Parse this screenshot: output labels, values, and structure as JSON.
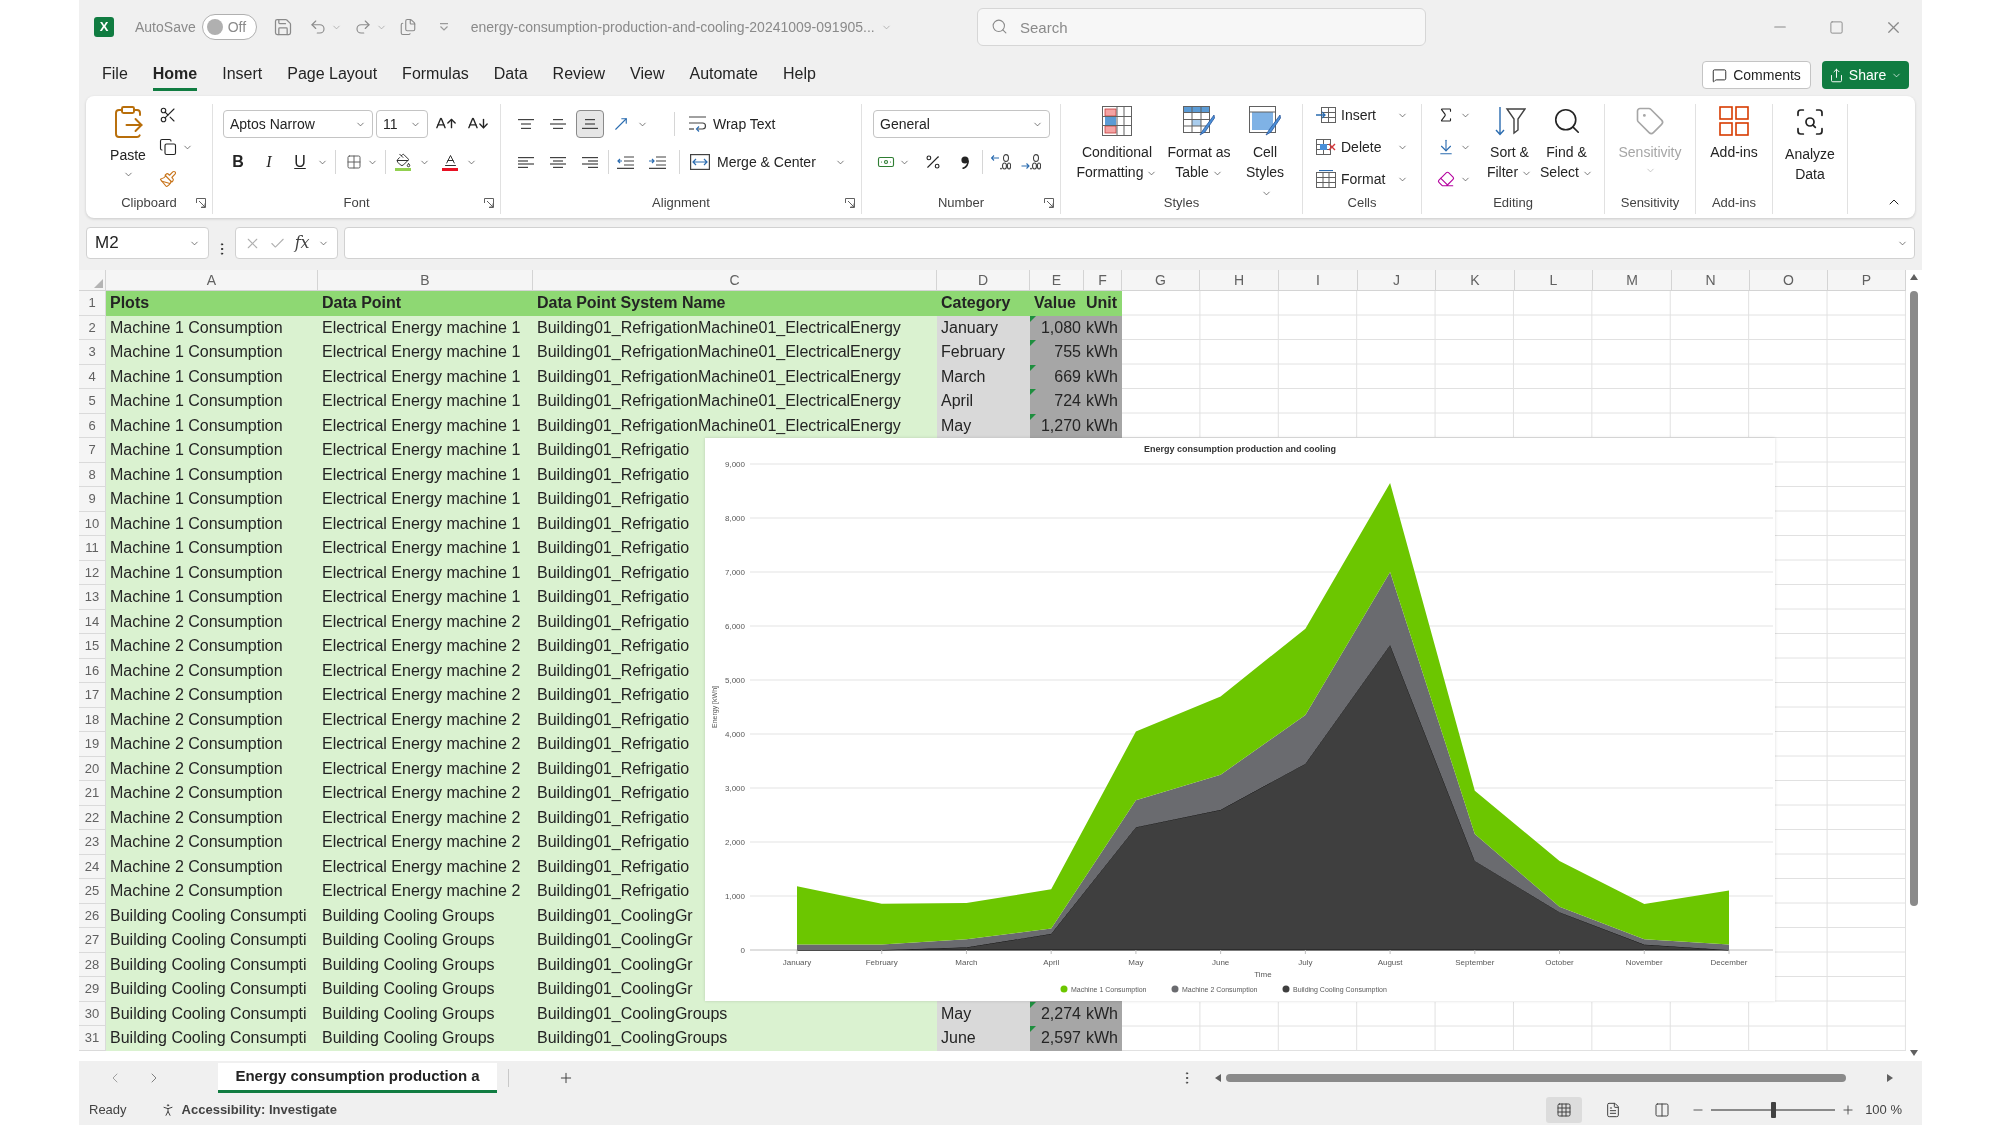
{
  "title_bar": {
    "logo_letter": "X",
    "autosave_label": "AutoSave",
    "autosave_toggle": {
      "on": false,
      "label": "Off"
    },
    "file_name": "energy-consumption-production-and-cooling-20241009-091905...",
    "search": {
      "placeholder": "Search"
    }
  },
  "menu_tabs": [
    {
      "label": "File",
      "selected": false
    },
    {
      "label": "Home",
      "selected": true
    },
    {
      "label": "Insert",
      "selected": false
    },
    {
      "label": "Page Layout",
      "selected": false
    },
    {
      "label": "Formulas",
      "selected": false
    },
    {
      "label": "Data",
      "selected": false
    },
    {
      "label": "Review",
      "selected": false
    },
    {
      "label": "View",
      "selected": false
    },
    {
      "label": "Automate",
      "selected": false
    },
    {
      "label": "Help",
      "selected": false
    }
  ],
  "comments_button": "Comments",
  "share_button": "Share",
  "ribbon": {
    "clipboard": {
      "label": "Clipboard",
      "paste": "Paste"
    },
    "font": {
      "label": "Font",
      "font_name": "Aptos Narrow",
      "font_size": "11",
      "style_buttons": [
        {
          "kind": "bold",
          "text": "B"
        },
        {
          "kind": "italic",
          "text": "I"
        },
        {
          "kind": "underline",
          "text": "U"
        }
      ]
    },
    "alignment": {
      "label": "Alignment",
      "vertical_align": [
        {
          "kind": "top",
          "selected": false
        },
        {
          "kind": "middle",
          "selected": false
        },
        {
          "kind": "bottom",
          "selected": true
        }
      ],
      "wrap_text": "Wrap Text",
      "merge_center": "Merge & Center"
    },
    "number": {
      "label": "Number",
      "format": "General"
    },
    "styles": {
      "label": "Styles",
      "buttons": [
        {
          "kind": "conditional",
          "text": "Conditional Formatting"
        },
        {
          "kind": "table",
          "text": "Format as Table"
        },
        {
          "kind": "cell_styles",
          "text": "Cell Styles"
        }
      ]
    },
    "cells": {
      "label": "Cells",
      "buttons": [
        {
          "kind": "insert",
          "text": "Insert"
        },
        {
          "kind": "delete",
          "text": "Delete"
        },
        {
          "kind": "format",
          "text": "Format"
        }
      ]
    },
    "editing": {
      "label": "Editing",
      "buttons": [
        {
          "kind": "sort",
          "text": "Sort & Filter"
        },
        {
          "kind": "find",
          "text": "Find & Select"
        }
      ]
    },
    "sensitivity": {
      "label": "Sensitivity",
      "button": "Sensitivity",
      "disabled": true
    },
    "add_ins": {
      "label": "Add-ins",
      "button": "Add-ins"
    },
    "analyze_data": {
      "button": "Analyze Data"
    }
  },
  "formula_bar": {
    "name_box": "M2",
    "function_label": "fx"
  },
  "sheet": {
    "columns": [
      "A",
      "B",
      "C",
      "D",
      "E",
      "F",
      "G",
      "H",
      "I",
      "J",
      "K",
      "L",
      "M",
      "N",
      "O",
      "P"
    ],
    "header_row": {
      "row_number": "1",
      "plots": "Plots",
      "data_point": "Data Point",
      "system_name": "Data Point System Name",
      "category": "Category",
      "value": "Value",
      "unit": "Unit"
    },
    "rows": [
      {
        "row_number": "2",
        "plots": "Machine 1 Consumption",
        "data_point": "Electrical Energy machine 1",
        "system_name": "Building01_RefrigationMachine01_ElectricalEnergy",
        "category": "January",
        "value": "1,080",
        "unit": "kWh",
        "value_flagged": true
      },
      {
        "row_number": "3",
        "plots": "Machine 1 Consumption",
        "data_point": "Electrical Energy machine 1",
        "system_name": "Building01_RefrigationMachine01_ElectricalEnergy",
        "category": "February",
        "value": "755",
        "unit": "kWh",
        "value_flagged": true
      },
      {
        "row_number": "4",
        "plots": "Machine 1 Consumption",
        "data_point": "Electrical Energy machine 1",
        "system_name": "Building01_RefrigationMachine01_ElectricalEnergy",
        "category": "March",
        "value": "669",
        "unit": "kWh",
        "value_flagged": true
      },
      {
        "row_number": "5",
        "plots": "Machine 1 Consumption",
        "data_point": "Electrical Energy machine 1",
        "system_name": "Building01_RefrigationMachine01_ElectricalEnergy",
        "category": "April",
        "value": "724",
        "unit": "kWh",
        "value_flagged": true
      },
      {
        "row_number": "6",
        "plots": "Machine 1 Consumption",
        "data_point": "Electrical Energy machine 1",
        "system_name": "Building01_RefrigationMachine01_ElectricalEnergy",
        "category": "May",
        "value": "1,270",
        "unit": "kWh",
        "value_flagged": true
      },
      {
        "row_number": "7",
        "plots": "Machine 1 Consumption",
        "data_point": "Electrical Energy machine 1",
        "system_name": "Building01_Refrigatio"
      },
      {
        "row_number": "8",
        "plots": "Machine 1 Consumption",
        "data_point": "Electrical Energy machine 1",
        "system_name": "Building01_Refrigatio"
      },
      {
        "row_number": "9",
        "plots": "Machine 1 Consumption",
        "data_point": "Electrical Energy machine 1",
        "system_name": "Building01_Refrigatio"
      },
      {
        "row_number": "10",
        "plots": "Machine 1 Consumption",
        "data_point": "Electrical Energy machine 1",
        "system_name": "Building01_Refrigatio"
      },
      {
        "row_number": "11",
        "plots": "Machine 1 Consumption",
        "data_point": "Electrical Energy machine 1",
        "system_name": "Building01_Refrigatio"
      },
      {
        "row_number": "12",
        "plots": "Machine 1 Consumption",
        "data_point": "Electrical Energy machine 1",
        "system_name": "Building01_Refrigatio"
      },
      {
        "row_number": "13",
        "plots": "Machine 1 Consumption",
        "data_point": "Electrical Energy machine 1",
        "system_name": "Building01_Refrigatio"
      },
      {
        "row_number": "14",
        "plots": "Machine 2 Consumption",
        "data_point": "Electrical Energy machine 2",
        "system_name": "Building01_Refrigatio"
      },
      {
        "row_number": "15",
        "plots": "Machine 2 Consumption",
        "data_point": "Electrical Energy machine 2",
        "system_name": "Building01_Refrigatio"
      },
      {
        "row_number": "16",
        "plots": "Machine 2 Consumption",
        "data_point": "Electrical Energy machine 2",
        "system_name": "Building01_Refrigatio"
      },
      {
        "row_number": "17",
        "plots": "Machine 2 Consumption",
        "data_point": "Electrical Energy machine 2",
        "system_name": "Building01_Refrigatio"
      },
      {
        "row_number": "18",
        "plots": "Machine 2 Consumption",
        "data_point": "Electrical Energy machine 2",
        "system_name": "Building01_Refrigatio"
      },
      {
        "row_number": "19",
        "plots": "Machine 2 Consumption",
        "data_point": "Electrical Energy machine 2",
        "system_name": "Building01_Refrigatio"
      },
      {
        "row_number": "20",
        "plots": "Machine 2 Consumption",
        "data_point": "Electrical Energy machine 2",
        "system_name": "Building01_Refrigatio"
      },
      {
        "row_number": "21",
        "plots": "Machine 2 Consumption",
        "data_point": "Electrical Energy machine 2",
        "system_name": "Building01_Refrigatio"
      },
      {
        "row_number": "22",
        "plots": "Machine 2 Consumption",
        "data_point": "Electrical Energy machine 2",
        "system_name": "Building01_Refrigatio"
      },
      {
        "row_number": "23",
        "plots": "Machine 2 Consumption",
        "data_point": "Electrical Energy machine 2",
        "system_name": "Building01_Refrigatio"
      },
      {
        "row_number": "24",
        "plots": "Machine 2 Consumption",
        "data_point": "Electrical Energy machine 2",
        "system_name": "Building01_Refrigatio"
      },
      {
        "row_number": "25",
        "plots": "Machine 2 Consumption",
        "data_point": "Electrical Energy machine 2",
        "system_name": "Building01_Refrigatio"
      },
      {
        "row_number": "26",
        "plots": "Building Cooling Consumpti",
        "data_point": "Building Cooling Groups",
        "system_name": "Building01_CoolingGr"
      },
      {
        "row_number": "27",
        "plots": "Building Cooling Consumpti",
        "data_point": "Building Cooling Groups",
        "system_name": "Building01_CoolingGr"
      },
      {
        "row_number": "28",
        "plots": "Building Cooling Consumpti",
        "data_point": "Building Cooling Groups",
        "system_name": "Building01_CoolingGr"
      },
      {
        "row_number": "29",
        "plots": "Building Cooling Consumpti",
        "data_point": "Building Cooling Groups",
        "system_name": "Building01_CoolingGr"
      },
      {
        "row_number": "30",
        "plots": "Building Cooling Consumpti",
        "data_point": "Building Cooling Groups",
        "system_name": "Building01_CoolingGroups",
        "category": "May",
        "value": "2,274",
        "unit": "kWh",
        "value_flagged": true
      },
      {
        "row_number": "31",
        "plots": "Building Cooling Consumpti",
        "data_point": "Building Cooling Groups",
        "system_name": "Building01_CoolingGroups",
        "category": "June",
        "value": "2,597",
        "unit": "kWh",
        "value_flagged": true
      }
    ]
  },
  "chart": {
    "chart_data": {
      "type": "area",
      "title": "Energy consumption production and cooling",
      "xlabel": "Time",
      "ylabel": "Energy [kWh]",
      "categories": [
        "January",
        "February",
        "March",
        "April",
        "May",
        "June",
        "July",
        "August",
        "September",
        "October",
        "November",
        "December"
      ],
      "series": [
        {
          "name": "Machine 1 Consumption",
          "color": "#6cc600",
          "values": [
            1080,
            755,
            669,
            724,
            1270,
            1450,
            1600,
            1650,
            800,
            850,
            650,
            1000
          ]
        },
        {
          "name": "Machine 2 Consumption",
          "color": "#6a6b6f",
          "values": [
            100,
            100,
            150,
            100,
            500,
            650,
            900,
            1350,
            500,
            100,
            100,
            100
          ]
        },
        {
          "name": "Building Cooling Consumption",
          "color": "#3f3f3f",
          "values": [
            0,
            0,
            50,
            300,
            2274,
            2597,
            3450,
            5650,
            1650,
            700,
            100,
            0
          ]
        }
      ],
      "ylim": [
        0,
        9000
      ],
      "yticks": [
        {
          "value": 0,
          "label": "0"
        },
        {
          "value": 1000,
          "label": "1,000"
        },
        {
          "value": 2000,
          "label": "2,000"
        },
        {
          "value": 3000,
          "label": "3,000"
        },
        {
          "value": 4000,
          "label": "4,000"
        },
        {
          "value": 5000,
          "label": "5,000"
        },
        {
          "value": 6000,
          "label": "6,000"
        },
        {
          "value": 7000,
          "label": "7,000"
        },
        {
          "value": 8000,
          "label": "8,000"
        },
        {
          "value": 9000,
          "label": "9,000"
        }
      ],
      "stacked": true,
      "grid": true,
      "legend": true
    }
  },
  "sheet_tabs": [
    {
      "label": "Energy consumption production a",
      "selected": true
    }
  ],
  "status_bar": {
    "status": "Ready",
    "accessibility": "Accessibility: Investigate",
    "views": [
      {
        "kind": "normal",
        "selected": true
      },
      {
        "kind": "page_layout",
        "selected": false
      },
      {
        "kind": "page_break",
        "selected": false
      }
    ],
    "zoom_slider": {
      "level": 0.5
    },
    "zoom": "100 %"
  }
}
